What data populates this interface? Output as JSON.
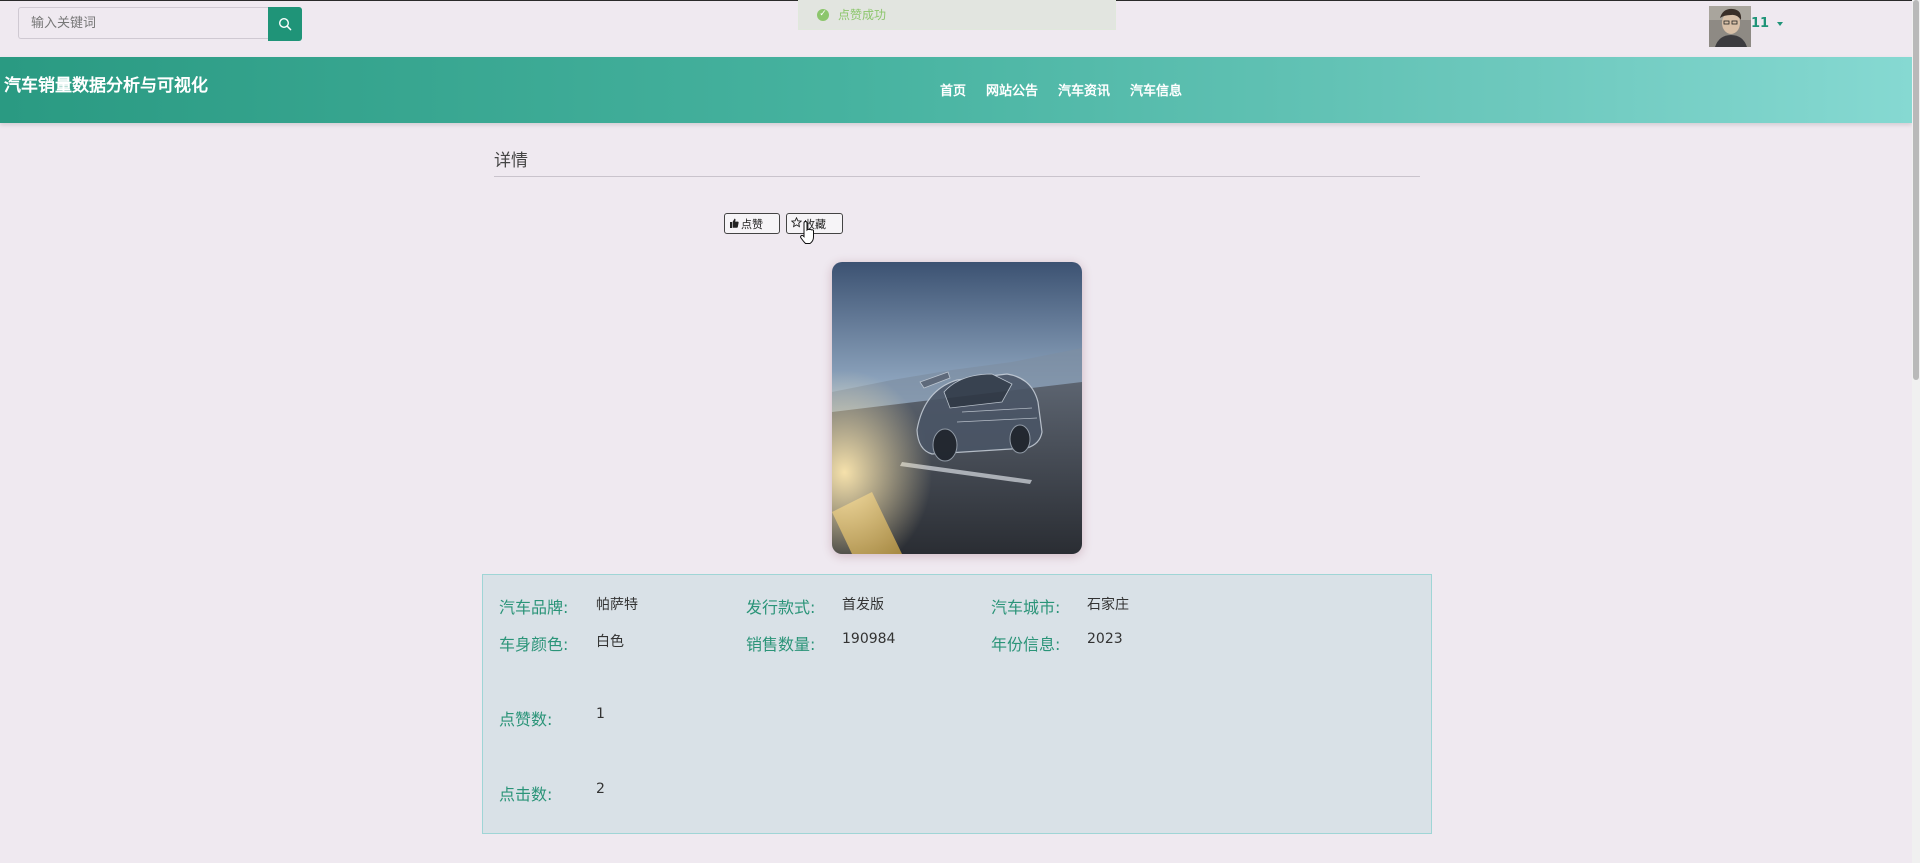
{
  "search": {
    "placeholder": "输入关键词"
  },
  "toast": {
    "message": "点赞成功"
  },
  "user": {
    "name": "11"
  },
  "site": {
    "title": "汽车销量数据分析与可视化"
  },
  "nav": {
    "items": [
      "首页",
      "网站公告",
      "汽车资讯",
      "汽车信息"
    ]
  },
  "detail": {
    "heading": "详情",
    "like_label": "点赞",
    "favorite_label": "收藏"
  },
  "info": {
    "brand_label": "汽车品牌:",
    "brand_value": "帕萨特",
    "style_label": "发行款式:",
    "style_value": "首发版",
    "city_label": "汽车城市:",
    "city_value": "石家庄",
    "color_label": "车身颜色:",
    "color_value": "白色",
    "sales_label": "销售数量:",
    "sales_value": "190984",
    "year_label": "年份信息:",
    "year_value": "2023",
    "likes_label": "点赞数:",
    "likes_value": "1",
    "clicks_label": "点击数:",
    "clicks_value": "2"
  },
  "colors": {
    "accent": "#1f9478",
    "nav_start": "#2a9a82",
    "nav_end": "#86d9d2",
    "toast_text": "#8cc66c"
  },
  "icons": {
    "search": "search-icon",
    "like": "thumbs-up-icon",
    "favorite": "star-icon",
    "success": "check-circle-icon"
  }
}
